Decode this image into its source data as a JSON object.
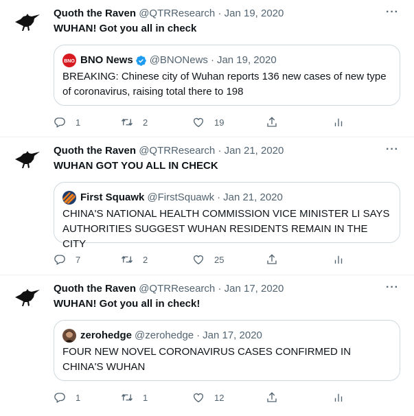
{
  "tweets": [
    {
      "name": "Quoth the Raven",
      "handle": "@QTRResearch",
      "sep": "·",
      "date": "Jan 19, 2020",
      "text": "WUHAN! Got you all in check",
      "quote": {
        "name": "BNO News",
        "handle": "@BNONews",
        "sep": "·",
        "date": "Jan 19, 2020",
        "avatar": "bno-news-logo-icon",
        "verified": true,
        "body": "BREAKING: Chinese city of Wuhan reports 136 new cases of new type of coronavirus, raising total there to 198"
      },
      "replies": "1",
      "retweets": "2",
      "likes": "19"
    },
    {
      "name": "Quoth the Raven",
      "handle": "@QTRResearch",
      "sep": "·",
      "date": "Jan 21, 2020",
      "text": "WUHAN GOT YOU ALL IN CHECK",
      "quote": {
        "name": "First Squawk",
        "handle": "@FirstSquawk",
        "sep": "·",
        "date": "Jan 21, 2020",
        "avatar": "first-squawk-logo-icon",
        "verified": false,
        "body": "CHINA'S NATIONAL HEALTH COMMISSION VICE MINISTER LI SAYS AUTHORITIES SUGGEST WUHAN RESIDENTS REMAIN IN THE CITY"
      },
      "replies": "7",
      "retweets": "2",
      "likes": "25"
    },
    {
      "name": "Quoth the Raven",
      "handle": "@QTRResearch",
      "sep": "·",
      "date": "Jan 17, 2020",
      "text": "WUHAN! Got you all in check!",
      "quote": {
        "name": "zerohedge",
        "handle": "@zerohedge",
        "sep": "·",
        "date": "Jan 17, 2020",
        "avatar": "zerohedge-avatar-icon",
        "verified": false,
        "body": "FOUR NEW NOVEL CORONAVIRUS CASES CONFIRMED IN CHINA'S WUHAN"
      },
      "replies": "1",
      "retweets": "1",
      "likes": "12"
    }
  ],
  "more_label": "···",
  "colors": {
    "text": "#0f1419",
    "muted": "#536471",
    "border": "#cfd9de",
    "verified": "#1d9bf0"
  },
  "icons": {
    "avatar": "raven-icon",
    "reply": "reply-icon",
    "retweet": "retweet-icon",
    "like": "heart-icon",
    "share": "share-icon",
    "stats": "analytics-icon"
  }
}
